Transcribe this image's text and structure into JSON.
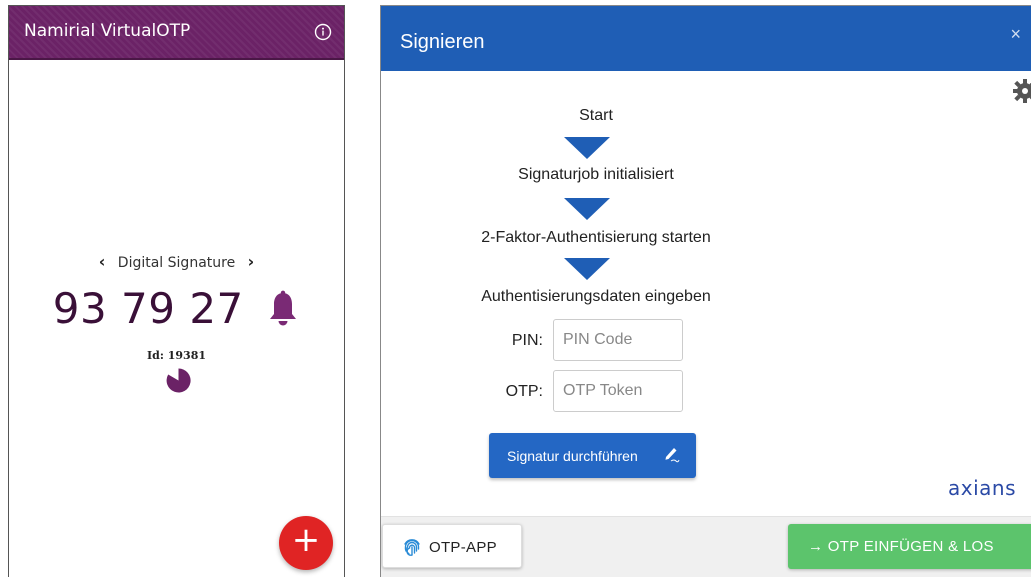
{
  "phone_app": {
    "title": "Namirial VirtualOTP",
    "icons": {
      "info": "info-circle-icon",
      "bell": "bell-icon",
      "timer": "pie-timer-icon",
      "add": "plus-icon"
    },
    "carousel": {
      "prev": "‹",
      "label": "Digital Signature",
      "next": "›"
    },
    "otp_code": "93 79 27",
    "otp_id": "Id: 19381",
    "fab_label": "+",
    "colors": {
      "header": "#6b2266",
      "code": "#3a1038",
      "bell": "#7a2a75",
      "fab": "#e02424"
    }
  },
  "dialog": {
    "title": "Signieren",
    "close_label": "×",
    "steps": [
      "Start",
      "Signaturjob initialisiert",
      "2-Faktor-Authentisierung starten",
      "Authentisierungsdaten eingeben"
    ],
    "pin": {
      "label": "PIN:",
      "placeholder": "PIN Code",
      "value": ""
    },
    "otp": {
      "label": "OTP:",
      "placeholder": "OTP Token",
      "value": ""
    },
    "sign_button": "Signatur durchführen",
    "brand": "axians",
    "footer": {
      "otp_app_button": "OTP-APP",
      "otp_insert_button": "→ OTP EINFÜGEN & LOS"
    },
    "colors": {
      "header": "#1f5eb5",
      "primary_button": "#2467c4",
      "success_button": "#5cc46c",
      "brand": "#2b4aa6"
    }
  }
}
